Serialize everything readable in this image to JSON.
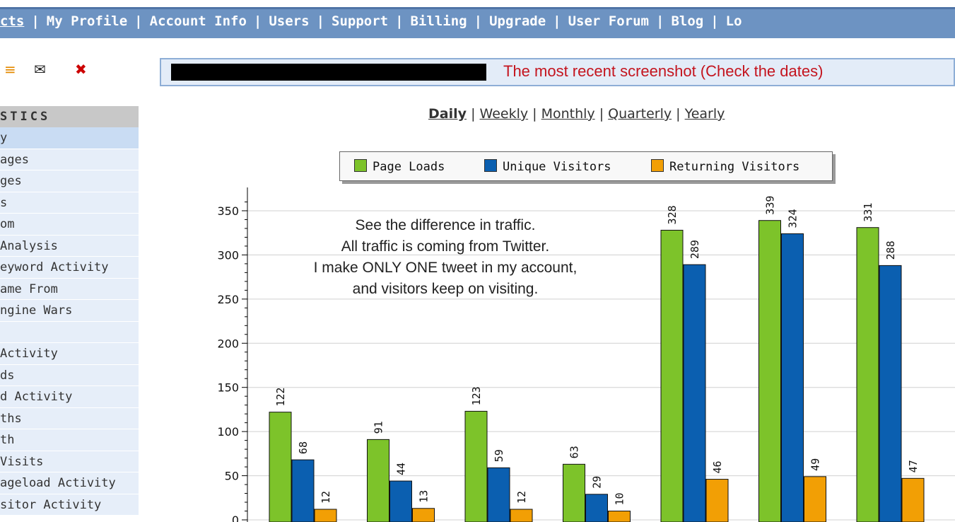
{
  "nav": [
    "cts",
    "My Profile",
    "Account Info",
    "Users",
    "Support",
    "Billing",
    "Upgrade",
    "User Forum",
    "Blog",
    "Lo"
  ],
  "toolbar_icons": [
    "rss-icon",
    "mail-icon",
    "trash-icon"
  ],
  "sidebar": {
    "heading": "STICS",
    "items": [
      "y",
      "ages",
      "ges",
      "s",
      "om",
      " Analysis",
      "eyword Activity",
      "ame From",
      "ngine Wars",
      "",
      " Activity",
      "ds",
      "d Activity",
      "ths",
      "th",
      " Visits",
      "ageload Activity",
      "sitor Activity"
    ]
  },
  "banner": {
    "text": "The most recent screenshot (Check the dates)"
  },
  "periods": {
    "daily": "Daily",
    "weekly": "Weekly",
    "monthly": "Monthly",
    "quarterly": "Quarterly",
    "yearly": "Yearly"
  },
  "annotation": [
    "See the difference in traffic.",
    "All traffic is coming from Twitter.",
    "I make ONLY ONE tweet in my account,",
    "and visitors keep on visiting."
  ],
  "colors": {
    "page_loads": "#7dc32a",
    "unique_visitors": "#0b5fb0",
    "returning_visitors": "#f29f05"
  },
  "chart_data": {
    "type": "bar",
    "categories": [
      "",
      "",
      "",
      "",
      "",
      "",
      ""
    ],
    "series": [
      {
        "name": "Page Loads",
        "values": [
          122,
          91,
          123,
          63,
          328,
          339,
          331
        ]
      },
      {
        "name": "Unique Visitors",
        "values": [
          68,
          44,
          59,
          29,
          289,
          324,
          288
        ]
      },
      {
        "name": "Returning Visitors",
        "values": [
          12,
          13,
          12,
          10,
          46,
          49,
          47
        ]
      }
    ],
    "yticks": [
      0,
      50,
      100,
      150,
      200,
      250,
      300,
      350
    ],
    "ylim": [
      0,
      370
    ],
    "grid": true,
    "legend": "top"
  }
}
